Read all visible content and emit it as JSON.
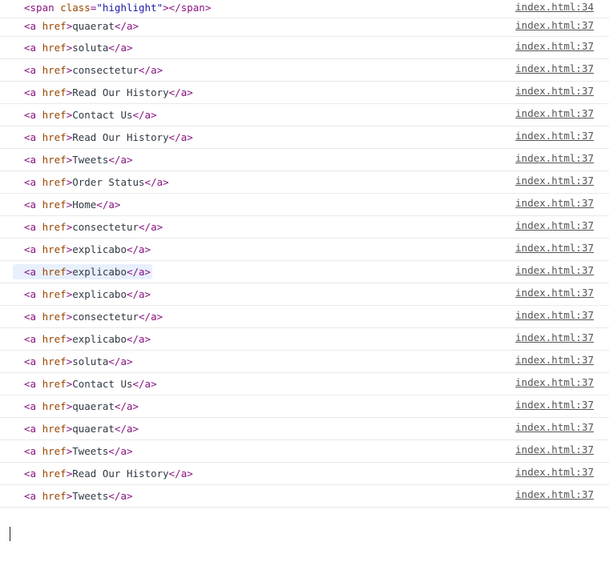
{
  "first_entry": {
    "open_tag": "<span",
    "attr": "class",
    "eq": "=",
    "value": "\"highlight\"",
    "close_open": ">",
    "close_tag": "</span>",
    "source": "index.html:34"
  },
  "anchor_markup": {
    "open": "<a",
    "attr": "href",
    "close_open": ">",
    "close_tag": "</a>"
  },
  "entries": [
    {
      "text": "quaerat",
      "source": "index.html:37",
      "highlighted": false
    },
    {
      "text": "soluta",
      "source": "index.html:37",
      "highlighted": false
    },
    {
      "text": "consectetur",
      "source": "index.html:37",
      "highlighted": false
    },
    {
      "text": "Read Our History",
      "source": "index.html:37",
      "highlighted": false
    },
    {
      "text": "Contact Us",
      "source": "index.html:37",
      "highlighted": false
    },
    {
      "text": "Read Our History",
      "source": "index.html:37",
      "highlighted": false
    },
    {
      "text": "Tweets",
      "source": "index.html:37",
      "highlighted": false
    },
    {
      "text": "Order Status",
      "source": "index.html:37",
      "highlighted": false
    },
    {
      "text": "Home",
      "source": "index.html:37",
      "highlighted": false
    },
    {
      "text": "consectetur",
      "source": "index.html:37",
      "highlighted": false
    },
    {
      "text": "explicabo",
      "source": "index.html:37",
      "highlighted": false
    },
    {
      "text": "explicabo",
      "source": "index.html:37",
      "highlighted": true
    },
    {
      "text": "explicabo",
      "source": "index.html:37",
      "highlighted": false
    },
    {
      "text": "consectetur",
      "source": "index.html:37",
      "highlighted": false
    },
    {
      "text": "explicabo",
      "source": "index.html:37",
      "highlighted": false
    },
    {
      "text": "soluta",
      "source": "index.html:37",
      "highlighted": false
    },
    {
      "text": "Contact Us",
      "source": "index.html:37",
      "highlighted": false
    },
    {
      "text": "quaerat",
      "source": "index.html:37",
      "highlighted": false
    },
    {
      "text": "quaerat",
      "source": "index.html:37",
      "highlighted": false
    },
    {
      "text": "Tweets",
      "source": "index.html:37",
      "highlighted": false
    },
    {
      "text": "Read Our History",
      "source": "index.html:37",
      "highlighted": false
    },
    {
      "text": "Tweets",
      "source": "index.html:37",
      "highlighted": false
    }
  ],
  "colors": {
    "tag": "#881280",
    "attribute": "#994500",
    "attribute_value": "#1a1aa6",
    "text": "#303942",
    "source_link": "#545454",
    "hover_highlight": "#e8f0fe"
  }
}
